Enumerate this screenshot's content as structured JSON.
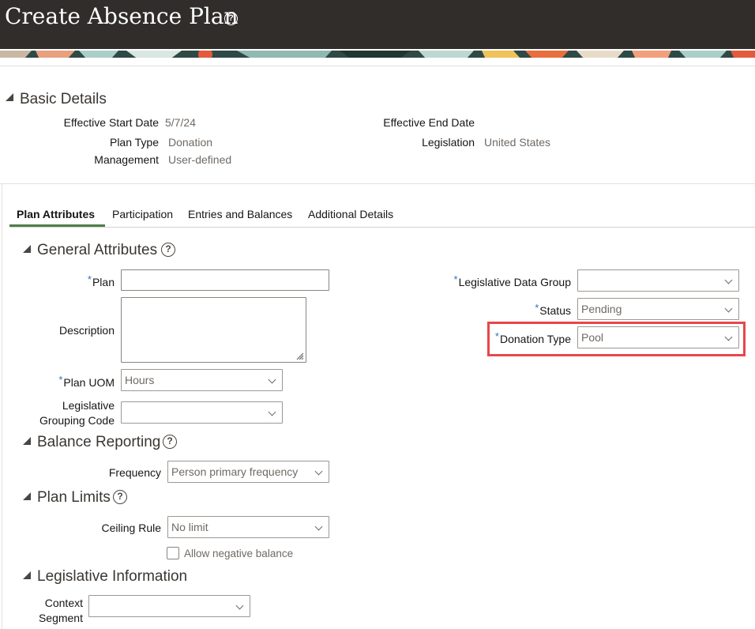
{
  "page": {
    "title": "Create Absence Plan"
  },
  "basic_details": {
    "title": "Basic Details",
    "effective_start_date_label": "Effective Start Date",
    "effective_start_date": "5/7/24",
    "plan_type_label": "Plan Type",
    "plan_type": "Donation",
    "management_label": "Management",
    "management": "User-defined",
    "effective_end_date_label": "Effective End Date",
    "legislation_label": "Legislation",
    "legislation": "United States"
  },
  "tabs": [
    {
      "label": "Plan Attributes",
      "active": true
    },
    {
      "label": "Participation"
    },
    {
      "label": "Entries and Balances"
    },
    {
      "label": "Additional Details"
    }
  ],
  "general_attributes": {
    "title": "General Attributes",
    "plan_label": "Plan",
    "plan_value": "",
    "description_label": "Description",
    "plan_uom_label": "Plan UOM",
    "plan_uom": "Hours",
    "legislative_grouping_code_label_1": "Legislative",
    "legislative_grouping_code_label_2": "Grouping Code",
    "legislative_grouping_code": "",
    "legislative_data_group_label": "Legislative Data Group",
    "legislative_data_group": "",
    "status_label": "Status",
    "status": "Pending",
    "donation_type_label": "Donation Type",
    "donation_type": "Pool"
  },
  "balance_reporting": {
    "title": "Balance Reporting",
    "frequency_label": "Frequency",
    "frequency": "Person primary frequency"
  },
  "plan_limits": {
    "title": "Plan Limits",
    "ceiling_rule_label": "Ceiling Rule",
    "ceiling_rule": "No limit",
    "allow_negative_balance_label": "Allow negative balance",
    "allow_negative_balance": false
  },
  "legislative_information": {
    "title": "Legislative Information",
    "context_segment_label_1": "Context",
    "context_segment_label_2": "Segment",
    "context_segment": ""
  },
  "required_marker": "*",
  "colors": {
    "header_bg": "#312d2a",
    "required": "#3273b9",
    "highlight": "#e8464a",
    "tab_active_underline": "#4f7d4a"
  },
  "icons": [
    "help-icon",
    "collapse-triangle-icon",
    "chevron-down-icon",
    "resize-grip-icon"
  ]
}
